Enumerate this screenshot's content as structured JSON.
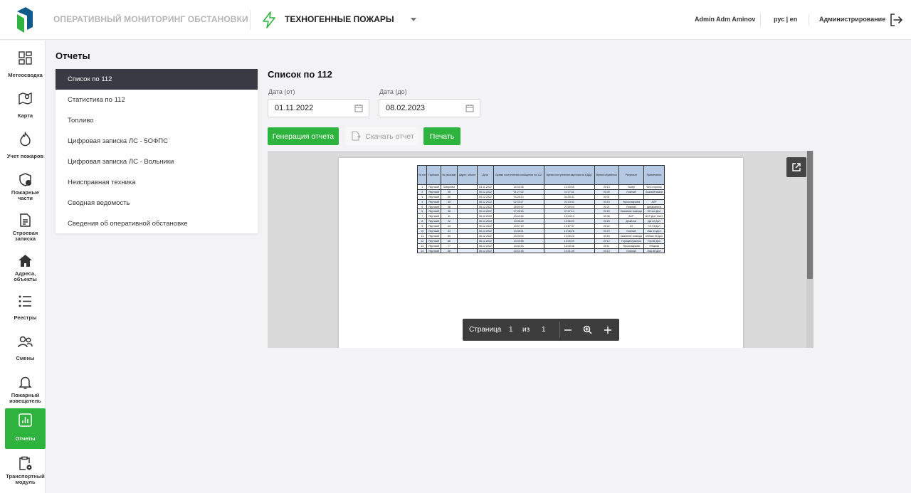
{
  "header": {
    "app_title": "ОПЕРАТИВНЫЙ МОНИТОРИНГ ОБСТАНОВКИ",
    "module_title": "ТЕХНОГЕННЫЕ ПОЖАРЫ",
    "user": "Admin Adm Aminov",
    "lang": "рус | en",
    "admin_link": "Администрирование"
  },
  "sidebar": {
    "items": [
      {
        "label": "Метеосводка",
        "icon": "dashboard-icon"
      },
      {
        "label": "Карта",
        "icon": "map-icon"
      },
      {
        "label": "Учет пожаров",
        "icon": "flame-icon"
      },
      {
        "label": "Пожарные части",
        "icon": "shield-icon"
      },
      {
        "label": "Строевая записка",
        "icon": "document-icon"
      },
      {
        "label": "Адреса, объекты",
        "icon": "home-icon"
      },
      {
        "label": "Реестры",
        "icon": "list-icon"
      },
      {
        "label": "Смены",
        "icon": "users-icon"
      },
      {
        "label": "Пожарный извещатель",
        "icon": "bell-icon"
      },
      {
        "label": "Отчеты",
        "icon": "chart-icon"
      },
      {
        "label": "Транспортный модуль",
        "icon": "clipboard-gear-icon"
      }
    ],
    "active_index": 9
  },
  "page": {
    "title": "Отчеты"
  },
  "reports_menu": [
    "Список по 112",
    "Статистика по 112",
    "Топливо",
    "Цифровая записка ЛС - 5ОФПС",
    "Цифровая записка ЛС - Вольники",
    "Неисправная техника",
    "Сводная ведомость",
    "Сведения об оперативной обстановке"
  ],
  "content": {
    "title": "Список по 112",
    "date_from_label": "Дата (от)",
    "date_from_value": "01.11.2022",
    "date_to_label": "Дата (до)",
    "date_to_value": "08.02.2023",
    "generate_button": "Генерация отчета",
    "download_button": "Скачать отчет",
    "print_button": "Печать"
  },
  "viewer": {
    "pager_label": "Страница",
    "page_current": "1",
    "page_of": "из",
    "page_total": "1",
    "table_headers": [
      "№ п/п",
      "Гарнизон",
      "№ (вызова)",
      "Адрес, объект",
      "Дата",
      "Время поступления сообщения на 112",
      "Время поступления карточки на ЕДДС",
      "Время обработки",
      "Результат",
      "Примечание"
    ],
    "table_rows": [
      [
        "1",
        "Якутский",
        "Шахрейм",
        "",
        "03.11.2022",
        "14:33:36",
        "14:33:55",
        "00:13",
        "Гомер",
        "Без стороны"
      ],
      [
        "2",
        "Якутский",
        "56",
        "",
        "05.12.2022",
        "01:27:02",
        "01:27:41",
        "00:39",
        "Ложный",
        "Ложный вызов"
      ],
      [
        "3",
        "Якутский",
        "60",
        "",
        "05.12.2022",
        "04:28:10",
        "04:28:41",
        "00:31",
        "",
        ""
      ],
      [
        "4",
        "Якутский",
        "55",
        "",
        "06.12.2022",
        "02:33:27",
        "02:33:43",
        "00:15",
        "Угроза взрыва",
        "АЛР"
      ],
      [
        "5",
        "Якутский",
        "56",
        "",
        "06.12.2022",
        "26:59:42",
        "27:00:04",
        "00:21",
        "Ложный",
        "депараната"
      ],
      [
        "6",
        "Якутский",
        "58",
        "",
        "06.12.2022",
        "07:06:54",
        "07:07:14",
        "00:20",
        "Оказание помощи",
        "Об окн Дол"
      ],
      [
        "7",
        "Якутский",
        "11",
        "",
        "06.12.2022",
        "13:43:34",
        "13:44:13",
        "00:46",
        "АСР",
        "АСР Дол текст"
      ],
      [
        "8",
        "Якутский",
        "22",
        "",
        "06.12.2022",
        "13:06:28",
        "13:06:03",
        "00:25",
        "Дежёлок",
        "Дж 22 Дол"
      ],
      [
        "9",
        "Якутский",
        "33",
        "",
        "06.12.2022",
        "13:57:19",
        "13:57:37",
        "00:22",
        "ХЗ",
        "ХЗ 33 Дол"
      ],
      [
        "10",
        "Якутский",
        "44",
        "",
        "06.12.2022",
        "13:38:01",
        "13:38:26",
        "00:23",
        "Ложный",
        "Лож 44 Дол"
      ],
      [
        "11",
        "Якутский",
        "55",
        "",
        "06.12.2022",
        "13:39:04",
        "13:39:24",
        "00:16",
        "Оказание помощи",
        "ОпПом 55 Дол"
      ],
      [
        "12",
        "Якутский",
        "66",
        "",
        "06.12.2022",
        "13:39:58",
        "13:40:09",
        "00:12",
        "Горящее/расхож",
        "Гор 66 Дол"
      ],
      [
        "13",
        "Якутский",
        "77",
        "",
        "06.12.2022",
        "13:40:34",
        "13:40:46",
        "00:11",
        "Угроза взрыва",
        "УгВзрыв"
      ],
      [
        "14",
        "Якутский",
        "88",
        "",
        "06.12.2022",
        "13:41:36",
        "13:41:49",
        "00:13",
        "Ложный",
        "Лож 88 Дол"
      ]
    ]
  },
  "colors": {
    "accent": "#2fb33f",
    "logo": "#1d9f58",
    "dark": "#3a3a44"
  }
}
